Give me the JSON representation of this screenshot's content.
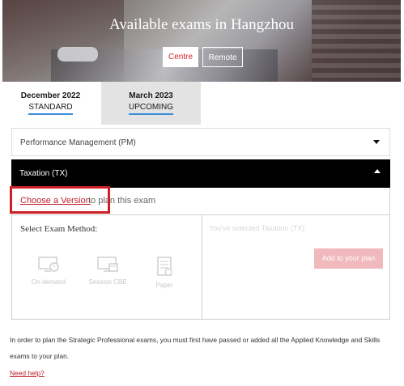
{
  "hero": {
    "title": "Available exams in Hangzhou",
    "centre_label": "Centre",
    "remote_label": "Remote"
  },
  "tabs": [
    {
      "month": "December 2022",
      "status": "STANDARD"
    },
    {
      "month": "March 2023",
      "status": "UPCOMING"
    }
  ],
  "accordion": {
    "pm_label": "Performance Management (PM)",
    "tx_label": "Taxation (TX)"
  },
  "panel": {
    "choose_link": "Choose a Version",
    "choose_rest": "to plan this exam",
    "method_label": "Select Exam Method:",
    "methods": [
      "On-demand",
      "Session CBE",
      "Paper"
    ],
    "selected_text": "You've selected Taxation (TX)",
    "add_button": "Add to your plan"
  },
  "footer": {
    "note": "In order to plan the Strategic Professional exams, you must first have passed or added all the Applied Knowledge and Skills exams to your plan.",
    "help_link": "Need help?"
  },
  "colors": {
    "accent_red": "#d21e2b",
    "tab_underline": "#3a8fd8",
    "add_button_disabled": "#f0b9bd"
  }
}
